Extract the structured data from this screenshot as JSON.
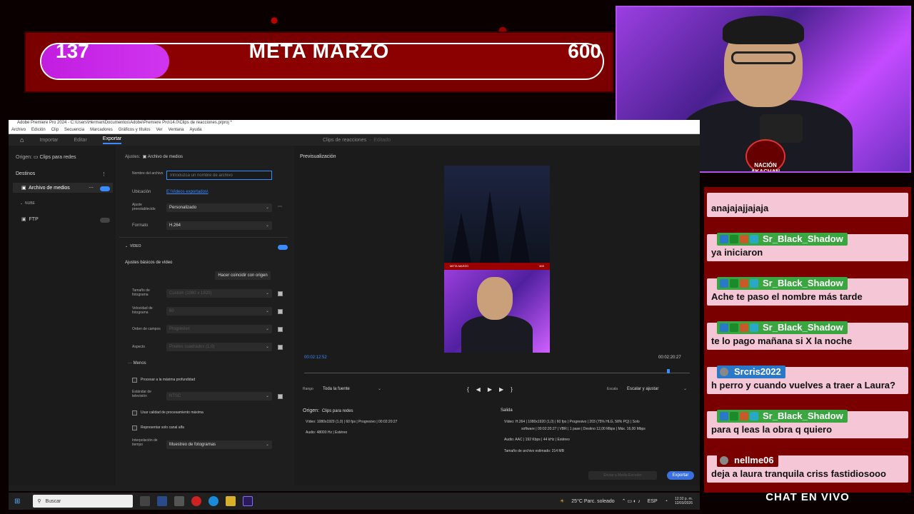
{
  "goal": {
    "current": "137",
    "title": "META MARZO",
    "target": "600",
    "progress": 0.228
  },
  "cam": {
    "badge": "NACIÓN AKACHAN"
  },
  "premiere": {
    "titlebar": "Adobe Premiere Pro 2024 - C:\\Users\\Herman\\Documentos\\Adobe\\Premiere Pro\\14.0\\Clips de reacciones.prproj *",
    "menu": [
      "Archivo",
      "Edición",
      "Clip",
      "Secuencia",
      "Marcadores",
      "Gráficos y títulos",
      "Ver",
      "Ventana",
      "Ayuda"
    ],
    "tabs": {
      "home": "⌂",
      "import": "Importar",
      "edit": "Editar",
      "export": "Exportar"
    },
    "project": "Clips de reacciones",
    "project_state": "Editado",
    "left": {
      "origin_label": "Origen:",
      "origin_value": "Clips para redes",
      "destinations": "Destinos",
      "media_file": "Archivo de medios",
      "group": "NUBE",
      "ftp": "FTP"
    },
    "settings": {
      "label": "Ajustes:",
      "value": "Archivo de medios",
      "name_label": "Nombre del archivo",
      "name_placeholder": "Introduzca un nombre de archivo",
      "location_label": "Ubicación",
      "location_value": "E:\\Videos exportados\\",
      "preset_label": "Ajuste preestablecido",
      "preset_value": "Personalizado",
      "format_label": "Formato",
      "format_value": "H.264",
      "video_section": "VÍDEO",
      "basic_label": "Ajustes básicos de vídeo",
      "match_button": "Hacer coincidir con origen",
      "frame_size_label": "Tamaño de fotograma",
      "frame_size_value": "Custom (1080 x 1920)",
      "frame_rate_label": "Velocidad de fotograma",
      "frame_rate_value": "60",
      "field_order_label": "Orden de campos",
      "field_order_value": "Progresivo",
      "aspect_label": "Aspecto",
      "aspect_value": "Píxeles cuadrados (1,0)",
      "less": "··· Menos",
      "max_depth": "Procesar a la máxima profundidad",
      "tv_std_label": "Estándar de televisión",
      "tv_std_value": "NTSC",
      "max_quality": "Usar calidad de procesamiento máxima",
      "alpha": "Representar solo canal alfa",
      "interp_label": "Interpolación de tiempo",
      "interp_value": "Muestreo de fotogramas"
    },
    "preview": {
      "title": "Previsualización",
      "current": "00:02:12:52",
      "duration": "00:02:20:27",
      "range_label": "Rango",
      "range_value": "Toda la fuente",
      "scale_label": "Escala",
      "scale_value": "Escalar y ajustar",
      "thumb_title": "META MARZO",
      "thumb_value": "600"
    },
    "source": {
      "label": "Origen:",
      "name": "Clips para redes",
      "video": "Vídeo:  1080x1920 (1,0)  |  60 fps  |  Progresivo  |  00:02:20:27",
      "audio": "Audio:  48000 Hz  |  Estéreo"
    },
    "output": {
      "label": "Salida",
      "video": "Vídeo:  H.264  |  1080x1920 (1,0)  |  60 fps  |  Progresivo  |  203 (75% HLG, 58% PQ)  |  Solo",
      "video2": "software  |  00:02:20:27  |  VBR  |  1 pase  |  Destino 12,00 Mbps  |  Máx. 16,00 Mbps",
      "audio": "Audio:  AAC  |  192 Kbps  |  44 kHz  |  Estéreo",
      "size": "Tamaño de archivo estimado:  214 MB"
    },
    "send_button": "Enviar a Media Encoder",
    "export_button": "Exportar"
  },
  "chat": {
    "title": "CHAT EN VIVO",
    "colors": {
      "pink": "#f4c6d6",
      "green": "#3aa640",
      "blue": "#2a78c8",
      "red": "#7a0000"
    },
    "messages": [
      {
        "user": "",
        "text": "anajajajjajaja"
      },
      {
        "user": "Sr_Black_Shadow",
        "text": "ya iniciaron"
      },
      {
        "user": "Sr_Black_Shadow",
        "text": "Ache te paso el nombre más tarde"
      },
      {
        "user": "Sr_Black_Shadow",
        "text": "te lo pago mañana si X la noche"
      },
      {
        "user": "Srcris2022",
        "text": "h perro y cuando vuelves a traer a Laura?"
      },
      {
        "user": "Sr_Black_Shadow",
        "text": "para q leas la obra q quiero"
      },
      {
        "user": "nellme06",
        "text": "deja a laura tranquila criss fastidiosooo"
      }
    ]
  },
  "taskbar": {
    "search": "Buscar",
    "weather": "25°C  Parc. soleado",
    "lang": "ESP",
    "time": "12:32 p. m.",
    "date": "12/03/2026"
  }
}
